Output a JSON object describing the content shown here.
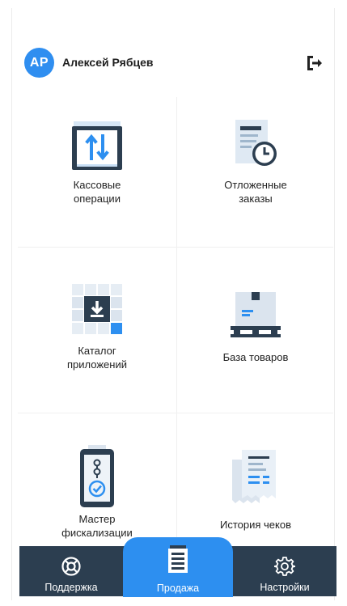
{
  "header": {
    "avatar_initials": "АР",
    "user_name": "Алексей Рябцев",
    "logout_icon": "logout-icon"
  },
  "tiles": [
    {
      "label_line1": "Кассовые",
      "label_line2": "операции",
      "icon": "cash-operations-icon"
    },
    {
      "label_line1": "Отложенные",
      "label_line2": "заказы",
      "icon": "deferred-orders-icon"
    },
    {
      "label_line1": "Каталог",
      "label_line2": "приложений",
      "icon": "app-catalog-icon"
    },
    {
      "label_line1": "База товаров",
      "label_line2": "",
      "icon": "product-base-icon"
    },
    {
      "label_line1": "Мастер",
      "label_line2": "фискализации",
      "icon": "fiscalization-wizard-icon"
    },
    {
      "label_line1": "История чеков",
      "label_line2": "",
      "icon": "receipt-history-icon"
    }
  ],
  "bottom_nav": {
    "support": "Поддержка",
    "sale": "Продажа",
    "settings": "Настройки"
  },
  "colors": {
    "accent": "#2d8ff0",
    "nav_background": "#2c3e50",
    "icon_dark": "#2c3e50"
  }
}
